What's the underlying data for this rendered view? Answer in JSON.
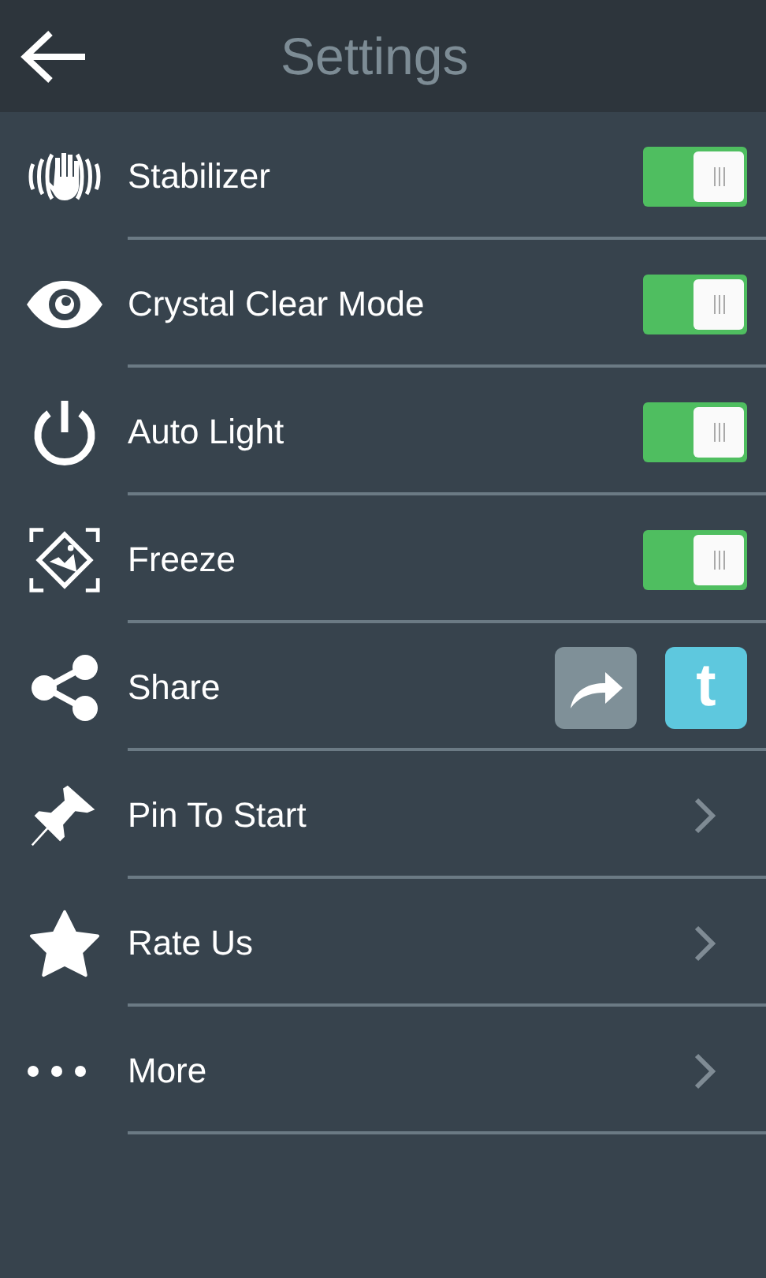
{
  "header": {
    "title": "Settings"
  },
  "items": [
    {
      "kind": "toggle",
      "label": "Stabilizer",
      "on": true
    },
    {
      "kind": "toggle",
      "label": "Crystal Clear Mode",
      "on": true
    },
    {
      "kind": "toggle",
      "label": "Auto Light",
      "on": true
    },
    {
      "kind": "toggle",
      "label": "Freeze",
      "on": true
    },
    {
      "kind": "share",
      "label": "Share",
      "buttons": [
        {
          "kind": "forward"
        },
        {
          "kind": "text",
          "label": "t"
        }
      ]
    },
    {
      "kind": "link",
      "label": "Pin To Start"
    },
    {
      "kind": "link",
      "label": "Rate Us"
    },
    {
      "kind": "link",
      "label": "More"
    }
  ]
}
